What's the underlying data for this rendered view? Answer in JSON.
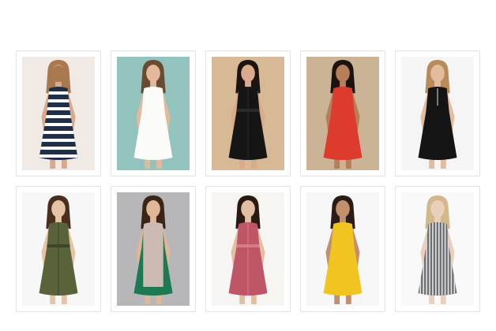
{
  "products": [
    {
      "bg": "#f1e9e4",
      "skin": "#d8a98a",
      "hair": "#a8784e",
      "dress": "#1f2f47",
      "accent": "#ffffff",
      "pattern": "stripes-h",
      "pose": "back"
    },
    {
      "bg": "#93c3bd",
      "skin": "#e2b99c",
      "hair": "#6b4a32",
      "dress": "#fbfbf8",
      "accent": "#e9e9e4",
      "pattern": "solid",
      "pose": "front"
    },
    {
      "bg": "#d7b995",
      "skin": "#d9aa8b",
      "hair": "#1b1411",
      "dress": "#151515",
      "accent": "#2a2a2a",
      "pattern": "shirt",
      "pose": "front"
    },
    {
      "bg": "#cbb496",
      "skin": "#b77e5a",
      "hair": "#1b1310",
      "dress": "#dd3b2e",
      "accent": "#c92f24",
      "pattern": "solid",
      "pose": "front"
    },
    {
      "bg": "#f5f5f5",
      "skin": "#e3bb9d",
      "hair": "#b88c5a",
      "dress": "#141414",
      "accent": "#e8e8e8",
      "pattern": "necklace",
      "pose": "front"
    },
    {
      "bg": "#f7f7f7",
      "skin": "#e5c3a7",
      "hair": "#4a2f1f",
      "dress": "#58633a",
      "accent": "#3e4629",
      "pattern": "shirt",
      "pose": "front"
    },
    {
      "bg": "#b7b7b9",
      "skin": "#e0b697",
      "hair": "#3a2518",
      "dress": "#cdbbb3",
      "accent": "#1c7a52",
      "pattern": "colorblock",
      "pose": "front"
    },
    {
      "bg": "#f7f5f2",
      "skin": "#e2bfa3",
      "hair": "#2b1a12",
      "dress": "#bf5667",
      "accent": "#d97a88",
      "pattern": "shirt",
      "pose": "front"
    },
    {
      "bg": "#f7f7f7",
      "skin": "#c2906c",
      "hair": "#2b1d16",
      "dress": "#f2c41f",
      "accent": "#e0b210",
      "pattern": "solid",
      "pose": "front"
    },
    {
      "bg": "#f9f9f9",
      "skin": "#ead0bb",
      "hair": "#d2b88a",
      "dress": "#6b6e73",
      "accent": "#e6e6e6",
      "pattern": "stripes-v",
      "pose": "front"
    }
  ]
}
